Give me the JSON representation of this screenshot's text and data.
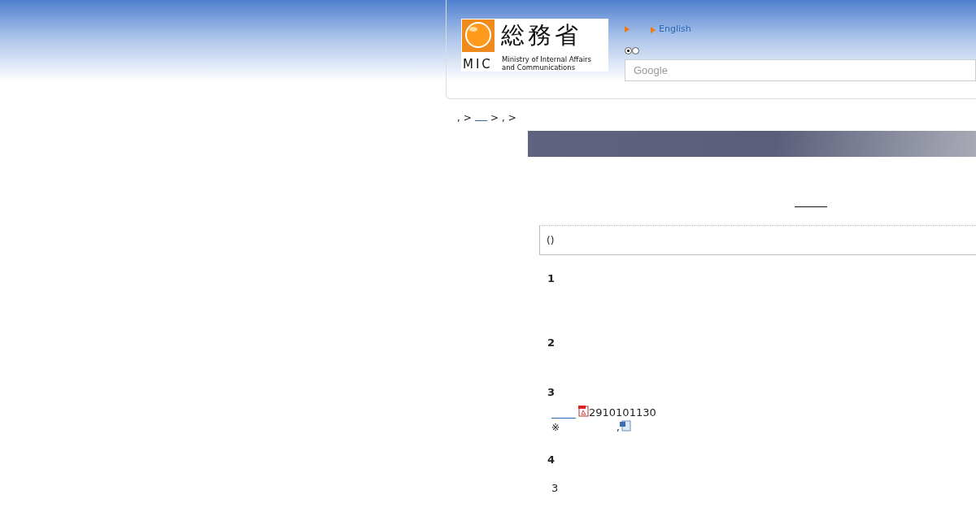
{
  "header": {
    "logo": {
      "mark": "MIC",
      "name": "総務省",
      "subtitle": "Ministry of Internal Affairs and Communications"
    },
    "links": [
      {
        "kind": "arrow"
      },
      {
        "kind": "link",
        "label": "English"
      }
    ],
    "search_scope": [
      {
        "selected": true
      },
      {
        "selected": false
      }
    ],
    "search": {
      "placeholder": "Google"
    }
  },
  "breadcrumb": [
    {
      "kind": "text",
      "text": ","
    },
    {
      "kind": "text",
      "text": ">"
    },
    {
      "kind": "link"
    },
    {
      "kind": "text",
      "text": ">"
    },
    {
      "kind": "text",
      "text": ","
    },
    {
      "kind": "text",
      "text": ">"
    }
  ],
  "notice": {
    "text": "()"
  },
  "sections": [
    {
      "heading": "1"
    },
    {
      "heading": "2"
    },
    {
      "heading": "3",
      "lines": [
        {
          "kind": "attachment",
          "text": "2910101130"
        },
        {
          "kind": "note",
          "mark": "※",
          "text": ","
        }
      ]
    },
    {
      "heading": "4",
      "lines": [
        {
          "kind": "plain",
          "text": "3"
        }
      ]
    }
  ]
}
